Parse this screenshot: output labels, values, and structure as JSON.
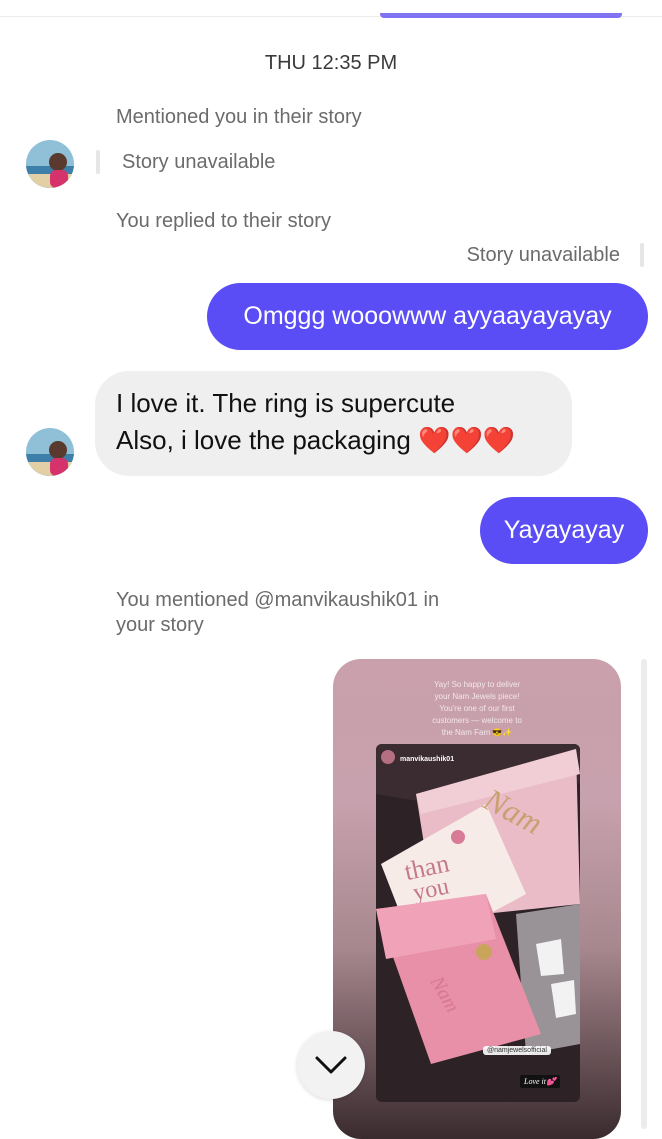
{
  "conversation": {
    "timestamp": "THU 12:35 PM",
    "mention_notice": "Mentioned you in their story",
    "story_unavailable_1": "Story unavailable",
    "reply_notice": "You replied to their story",
    "story_unavailable_2": "Story unavailable",
    "messages": [
      {
        "from": "me",
        "text": "Omggg wooowww ayyaayayayay"
      },
      {
        "from": "them",
        "line1": "I love it. The ring is supercute",
        "line2": "Also, i love the packaging ❤️❤️❤️"
      },
      {
        "from": "me",
        "text": "Yayayayay"
      }
    ],
    "you_mentioned_line1": "You mentioned @manvikaushik01 in",
    "you_mentioned_line2": "your story"
  },
  "story": {
    "caption": [
      "Yay! So happy to deliver",
      "your Nam Jewels piece!",
      "You're one of our first",
      "customers — welcome to",
      "the Nam Fam 😎✨"
    ],
    "repost_username": "manvikaushik01",
    "brand_tag": "@namjewelsofficial",
    "sticker_text": "Love it💕",
    "box_text": "thank you"
  },
  "icons": {
    "scroll_down": "chevron-down-icon"
  },
  "colors": {
    "accent": "#5b4df5",
    "incoming_bubble": "#efefef"
  }
}
